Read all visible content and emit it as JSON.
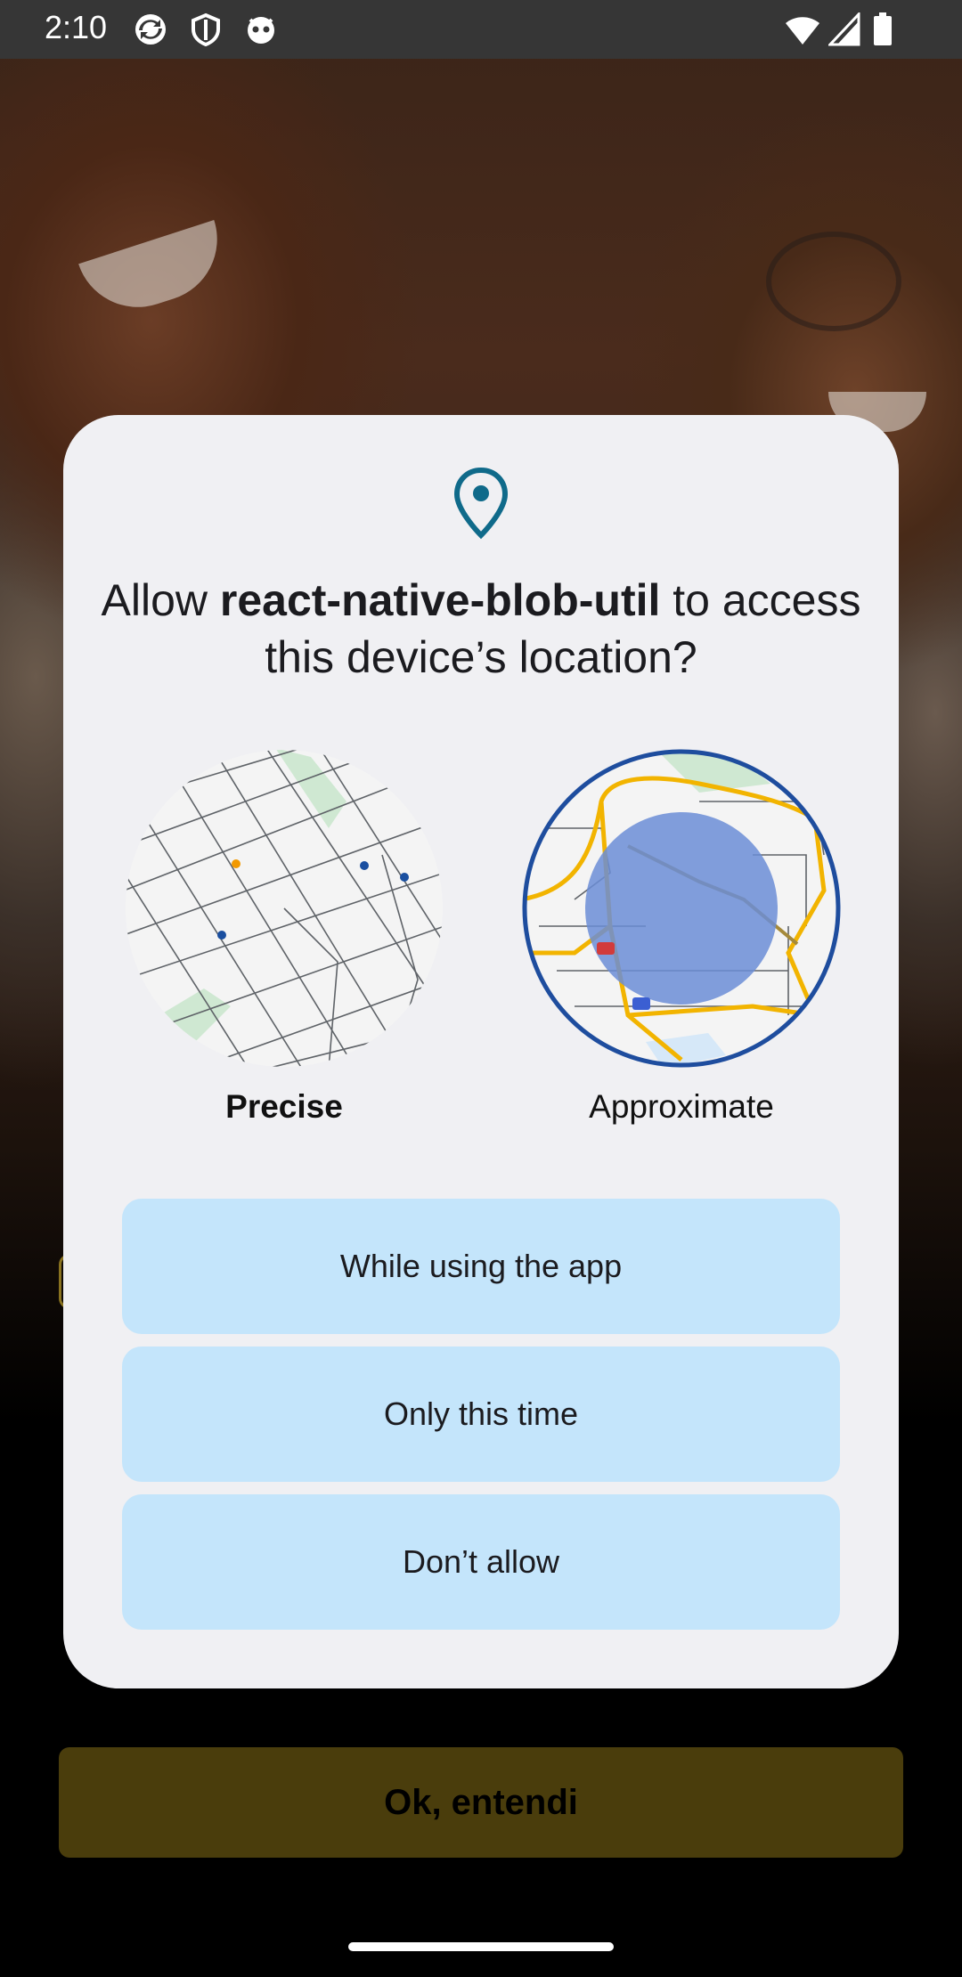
{
  "status_bar": {
    "time": "2:10",
    "left_icons": [
      "sync-app-icon",
      "shield-icon",
      "notification-app-icon"
    ],
    "right_icons": [
      "wifi-icon",
      "cell-signal-icon",
      "battery-icon"
    ]
  },
  "dialog": {
    "icon": "location-pin-icon",
    "title_prefix": "Allow ",
    "app_name": "react-native-blob-util",
    "title_suffix": " to access this device’s location?",
    "options": [
      {
        "label": "Precise",
        "selected": true
      },
      {
        "label": "Approximate",
        "selected": false
      }
    ],
    "buttons": {
      "while_using": "While using the app",
      "only_this_time": "Only this time",
      "dont_allow": "Don’t allow"
    },
    "colors": {
      "accent": "#0f6a8a",
      "button_bg": "#c4e5fb",
      "approx_ring": "#1e4d9e",
      "approx_fill": "#6b8dd6"
    }
  },
  "app": {
    "ok_button": "Ok, entendi",
    "ok_button_color": "#4a3d0c"
  }
}
